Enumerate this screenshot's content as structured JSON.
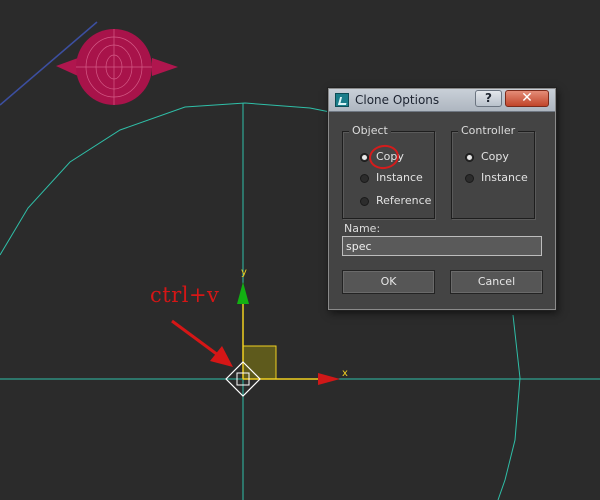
{
  "annotation": {
    "text": "ctrl+v"
  },
  "viewport": {
    "axis_x_label": "x",
    "axis_y_label": "y",
    "colors": {
      "background": "#2b2b2b",
      "guide": "#2fbfa8",
      "gizmo": "#f0d020",
      "arrow": "#d51616",
      "object": "#b0164e"
    }
  },
  "dialog": {
    "title": "Clone Options",
    "help_label": "?",
    "close_label": "✕",
    "object_group": {
      "label": "Object",
      "options": [
        {
          "label": "Copy",
          "selected": true
        },
        {
          "label": "Instance",
          "selected": false
        },
        {
          "label": "Reference",
          "selected": false
        }
      ]
    },
    "controller_group": {
      "label": "Controller",
      "options": [
        {
          "label": "Copy",
          "selected": true
        },
        {
          "label": "Instance",
          "selected": false
        }
      ]
    },
    "name_label": "Name:",
    "name_value": "spec",
    "ok_label": "OK",
    "cancel_label": "Cancel"
  }
}
